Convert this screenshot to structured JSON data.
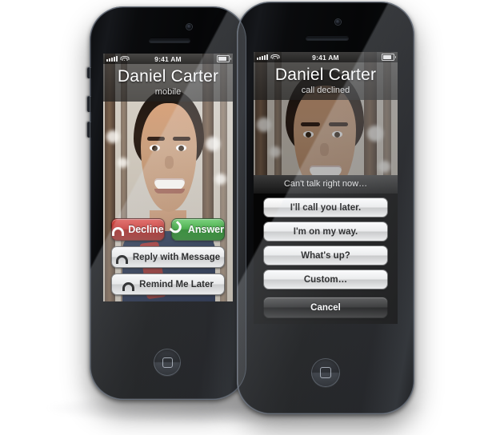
{
  "scene": {
    "background_color": "#ffffff",
    "device_count": 2
  },
  "status_bar": {
    "time": "9:41 AM",
    "signal_icon": "signal-bars-icon",
    "wifi_icon": "wifi-icon",
    "battery_icon": "battery-icon"
  },
  "phone_left": {
    "screen_name": "incoming-call-screen",
    "caller_name": "Daniel Carter",
    "caller_subtitle": "mobile",
    "decline_label": "Decline",
    "decline_icon": "phone-down-icon",
    "decline_color": "#c72c27",
    "answer_label": "Answer",
    "answer_icon": "phone-handset-icon",
    "answer_color": "#2fa32f",
    "reply_label": "Reply with Message",
    "reply_icon": "phone-down-icon",
    "remind_label": "Remind Me Later",
    "remind_icon": "phone-down-icon",
    "home_button": "home-button"
  },
  "phone_right": {
    "screen_name": "call-declined-reply-sheet",
    "caller_name": "Daniel Carter",
    "caller_subtitle": "call declined",
    "sheet_title": "Can't talk right now…",
    "options": [
      "I'll call you later.",
      "I'm on my way.",
      "What's up?",
      "Custom…"
    ],
    "cancel_label": "Cancel",
    "home_button": "home-button"
  }
}
